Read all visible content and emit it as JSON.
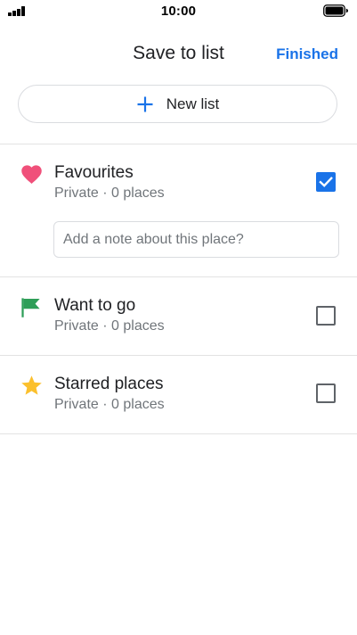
{
  "status_bar": {
    "time": "10:00",
    "signal_icon": "signal-bars-icon",
    "battery_icon": "battery-icon"
  },
  "header": {
    "title": "Save to list",
    "finished_label": "Finished"
  },
  "new_list": {
    "label": "New list",
    "icon": "plus-icon"
  },
  "lists": [
    {
      "name": "Favourites",
      "meta": "Private · 0 places",
      "icon": "heart-icon",
      "icon_color": "#f0507a",
      "checked": true
    },
    {
      "name": "Want to go",
      "meta": "Private · 0 places",
      "icon": "flag-icon",
      "icon_color": "#2e9e58",
      "checked": false
    },
    {
      "name": "Starred places",
      "meta": "Private · 0 places",
      "icon": "star-icon",
      "icon_color": "#fbc02d",
      "checked": false
    }
  ],
  "note": {
    "placeholder": "Add a note about this place?",
    "value": ""
  },
  "colors": {
    "accent": "#1a73e8"
  }
}
